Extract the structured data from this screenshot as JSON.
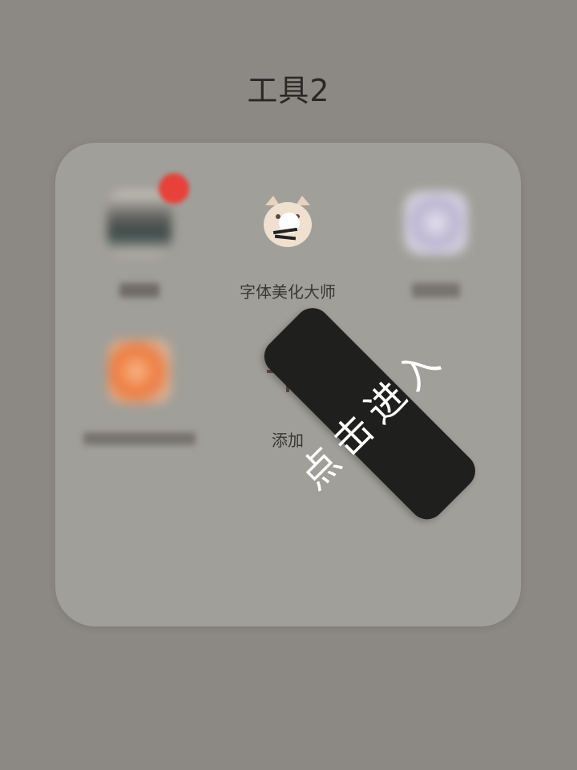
{
  "folder": {
    "title": "工具2",
    "apps": [
      {
        "label": "",
        "icon": "blurred-app-icon",
        "blurred": true,
        "has_badge": true,
        "badge_color": "#e7413a"
      },
      {
        "label": "字体美化大师",
        "icon": "cat-face-icon",
        "blurred": false
      },
      {
        "label": "",
        "icon": "blurred-app-icon",
        "blurred": true
      },
      {
        "label": "",
        "icon": "blurred-app-icon",
        "blurred": true
      },
      {
        "label": "添加",
        "icon": "plus-icon",
        "blurred": false
      }
    ]
  },
  "overlay": {
    "hint_text": "点击进入"
  },
  "colors": {
    "background": "#8c8984",
    "panel": "#a19f99",
    "title_text": "#2a2826",
    "hint_bg": "#1f1f1e",
    "hint_text": "#ffffff"
  }
}
